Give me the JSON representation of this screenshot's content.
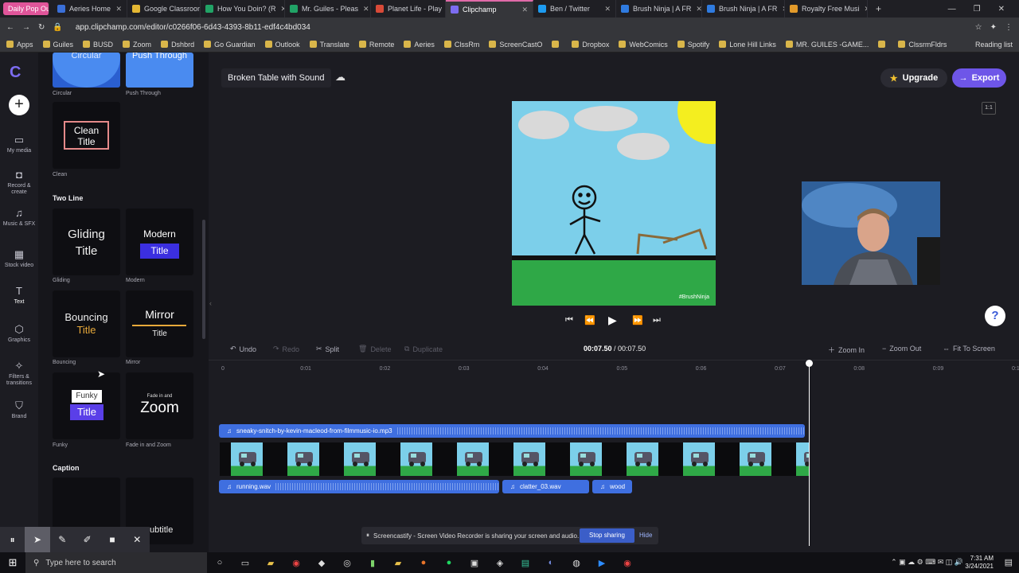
{
  "browser": {
    "tabs": [
      {
        "label": "Daily Pop Out",
        "color": "#e0559a",
        "pill": true
      },
      {
        "label": "Aeries Home",
        "color": "#3a6fd8"
      },
      {
        "label": "Google Classroom",
        "color": "#e4b733"
      },
      {
        "label": "How You Doin? (R",
        "color": "#21a366"
      },
      {
        "label": "Mr. Guiles - Pleas",
        "color": "#21a366"
      },
      {
        "label": "Planet Life - Play",
        "color": "#d94a38"
      },
      {
        "label": "Clipchamp",
        "color": "#7c6cf0",
        "active": true
      },
      {
        "label": "Ben / Twitter",
        "color": "#1d9bf0"
      },
      {
        "label": "Brush Ninja | A FR",
        "color": "#2f7be0"
      },
      {
        "label": "Brush Ninja | A FR",
        "color": "#2f7be0"
      },
      {
        "label": "Royalty Free Musi",
        "color": "#e29a2a"
      }
    ],
    "new_tab": "+",
    "url": "app.clipchamp.com/editor/c0266f06-6d43-4393-8b11-edf4c4bd034",
    "bookmarks": [
      "Apps",
      "Guiles",
      "BUSD",
      "Zoom",
      "Dshbrd",
      "Go Guardian",
      "Outlook",
      "Translate",
      "Remote",
      "Aeries",
      "ClssRm",
      "ScreenCastO",
      "",
      "Dropbox",
      "WebComics",
      "Spotify",
      "Lone Hill Links",
      "MR. GUILES -GAME...",
      "",
      "ClssrmFldrs"
    ],
    "reading_list": "Reading list"
  },
  "rail": {
    "items": [
      {
        "label": "My media",
        "icon": "folder-icon",
        "glyph": "▭"
      },
      {
        "label": "Record & create",
        "icon": "camera-icon",
        "glyph": "◘"
      },
      {
        "label": "Music & SFX",
        "icon": "music-icon",
        "glyph": "♫"
      },
      {
        "label": "Stock video",
        "icon": "film-icon",
        "glyph": "▦"
      },
      {
        "label": "Text",
        "icon": "text-icon",
        "glyph": "T"
      },
      {
        "label": "Graphics",
        "icon": "shapes-icon",
        "glyph": "⬡"
      },
      {
        "label": "Filters & transitions",
        "icon": "sparkle-icon",
        "glyph": "✧"
      },
      {
        "label": "Brand",
        "icon": "shield-icon",
        "glyph": "⛉"
      }
    ]
  },
  "panel": {
    "top_tiles": [
      {
        "label": "Circular",
        "text": "Circular"
      },
      {
        "label": "Push Through",
        "text": "Push Through"
      }
    ],
    "clean": {
      "label": "Clean",
      "line1": "Clean",
      "line2": "Title"
    },
    "sections": {
      "two_line": "Two Line",
      "caption": "Caption"
    },
    "gliding": {
      "label": "Gliding",
      "line1": "Gliding",
      "line2": "Title"
    },
    "modern": {
      "label": "Modern",
      "line1": "Modern",
      "line2": "Title"
    },
    "bouncing": {
      "label": "Bouncing",
      "line1": "Bouncing",
      "line2": "Title"
    },
    "mirror": {
      "label": "Mirror",
      "line1": "Mirror",
      "line2": "Title"
    },
    "funky": {
      "label": "Funky",
      "line1": "Funky",
      "line2": "Title"
    },
    "fadezoom": {
      "label": "Fade in and Zoom",
      "line1": "Fade in and",
      "line2": "Zoom"
    },
    "caption_tile_text": "ubtitle"
  },
  "editor": {
    "project_title": "Broken Table with Sound",
    "upgrade": "Upgrade",
    "export": "Export",
    "ratio": "1:1",
    "help": "?",
    "watermark": "#BrushNinja"
  },
  "timeline": {
    "tools": {
      "undo": "Undo",
      "redo": "Redo",
      "split": "Split",
      "delete": "Delete",
      "duplicate": "Duplicate",
      "zoom_in": "Zoom In",
      "zoom_out": "Zoom Out",
      "fit": "Fit To Screen"
    },
    "time_current": "00:07.50",
    "time_total": "00:07.50",
    "ticks": [
      "0",
      "0:01",
      "0:02",
      "0:03",
      "0:04",
      "0:05",
      "0:06",
      "0:07",
      "0:08",
      "0:09",
      "0:1"
    ],
    "music_clip": "sneaky-snitch-by-kevin-macleod-from-filmmusic-io.mp3",
    "sfx_clips": [
      "running.wav",
      "clatter_03.wav",
      "wood"
    ]
  },
  "screencastify": {
    "message": "Screencastify - Screen Video Recorder is sharing your screen and audio.",
    "stop": "Stop sharing",
    "hide": "Hide"
  },
  "taskbar": {
    "search_placeholder": "Type here to search",
    "time": "7:31 AM",
    "date": "3/24/2021"
  }
}
